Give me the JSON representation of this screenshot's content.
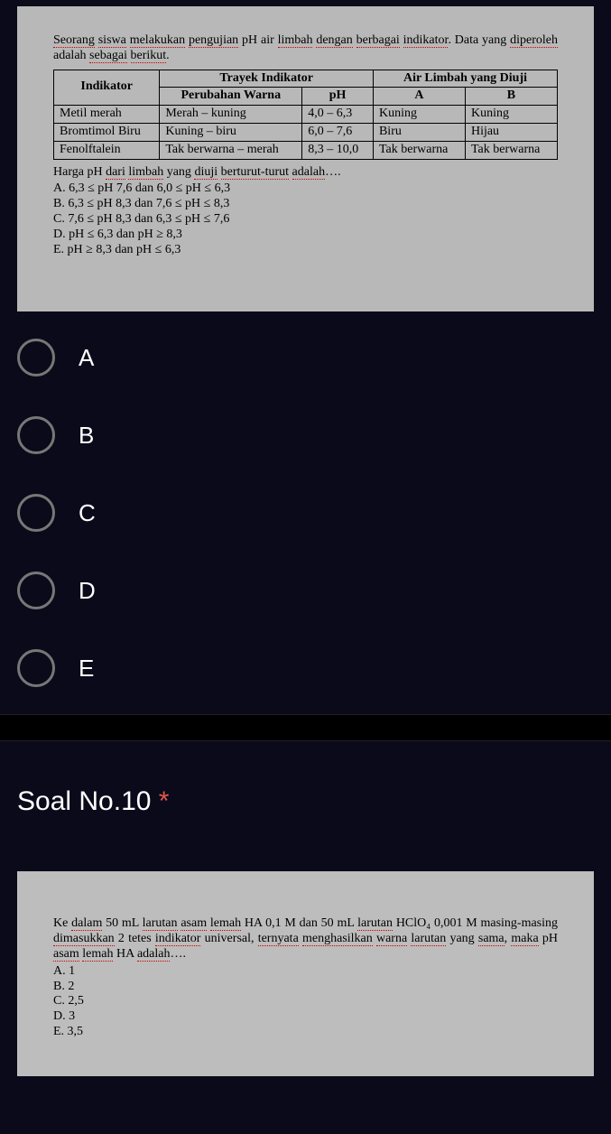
{
  "q9": {
    "intro_parts": [
      "Seorang",
      " ",
      "siswa",
      " ",
      "melakukan",
      " ",
      "pengujian",
      " pH air ",
      "limbah",
      " ",
      "dengan",
      " ",
      "berbagai",
      " ",
      "indikator",
      ". Data yang ",
      "diperoleh",
      " adalah ",
      "sebagai",
      " ",
      "berikut",
      "."
    ],
    "table": {
      "head_indikator": "Indikator",
      "head_trayek": "Trayek Indikator",
      "head_air": "Air Limbah yang Diuji",
      "sub_warna": "Perubahan  Warna",
      "sub_ph": "pH",
      "sub_a": "A",
      "sub_b": "B",
      "rows": [
        {
          "ind": "Metil merah",
          "warna": "Merah – kuning",
          "ph": "4,0 – 6,3",
          "a": "Kuning",
          "b": "Kuning"
        },
        {
          "ind": "Bromtimol Biru",
          "warna": "Kuning – biru",
          "ph": "6,0 – 7,6",
          "a": "Biru",
          "b": "Hijau"
        },
        {
          "ind": "Fenolftalein",
          "warna": "Tak berwarna – merah",
          "ph": "8,3 – 10,0",
          "a": "Tak berwarna",
          "b": "Tak berwarna"
        }
      ]
    },
    "prompt_parts": [
      "Harga pH ",
      "dari",
      " ",
      "limbah",
      " yang ",
      "diuji",
      " ",
      "berturut-turut",
      " ",
      "adalah",
      "…."
    ],
    "choices": [
      "A.   6,3 ≤ pH 7,6 dan 6,0 ≤ pH ≤ 6,3",
      "B.   6,3 ≤ pH 8,3 dan 7,6 ≤ pH ≤ 8,3",
      "C.   7,6 ≤ pH 8,3 dan 6,3 ≤ pH ≤ 7,6",
      "D.   pH ≤ 6,3 dan pH ≥ 8,3",
      "E.   pH ≥ 8,3 dan pH ≤ 6,3"
    ]
  },
  "answer_options": [
    {
      "label": "A"
    },
    {
      "label": "B"
    },
    {
      "label": "C"
    },
    {
      "label": "D"
    },
    {
      "label": "E"
    }
  ],
  "section2": {
    "title": "Soal No.10",
    "required_mark": "*"
  },
  "q10": {
    "intro_parts": [
      "Ke ",
      "dalam",
      " 50 mL ",
      "larutan",
      " ",
      "asam",
      " ",
      "lemah",
      " HA 0,1 M dan 50 mL ",
      "larutan",
      " HClO₄ 0,001 M masing-masing ",
      "dimasukkan",
      " 2 tetes ",
      "indikator",
      " universal, ",
      "ternyata",
      " ",
      "menghasilkan",
      " ",
      "warna",
      " ",
      "larutan",
      " yang ",
      "sama",
      ", ",
      "maka",
      " pH ",
      "asam",
      " ",
      "lemah",
      " HA ",
      "adalah",
      "…."
    ],
    "choices": [
      "A.   1",
      "B.   2",
      "C.   2,5",
      "D.   3",
      "E.   3,5"
    ]
  }
}
